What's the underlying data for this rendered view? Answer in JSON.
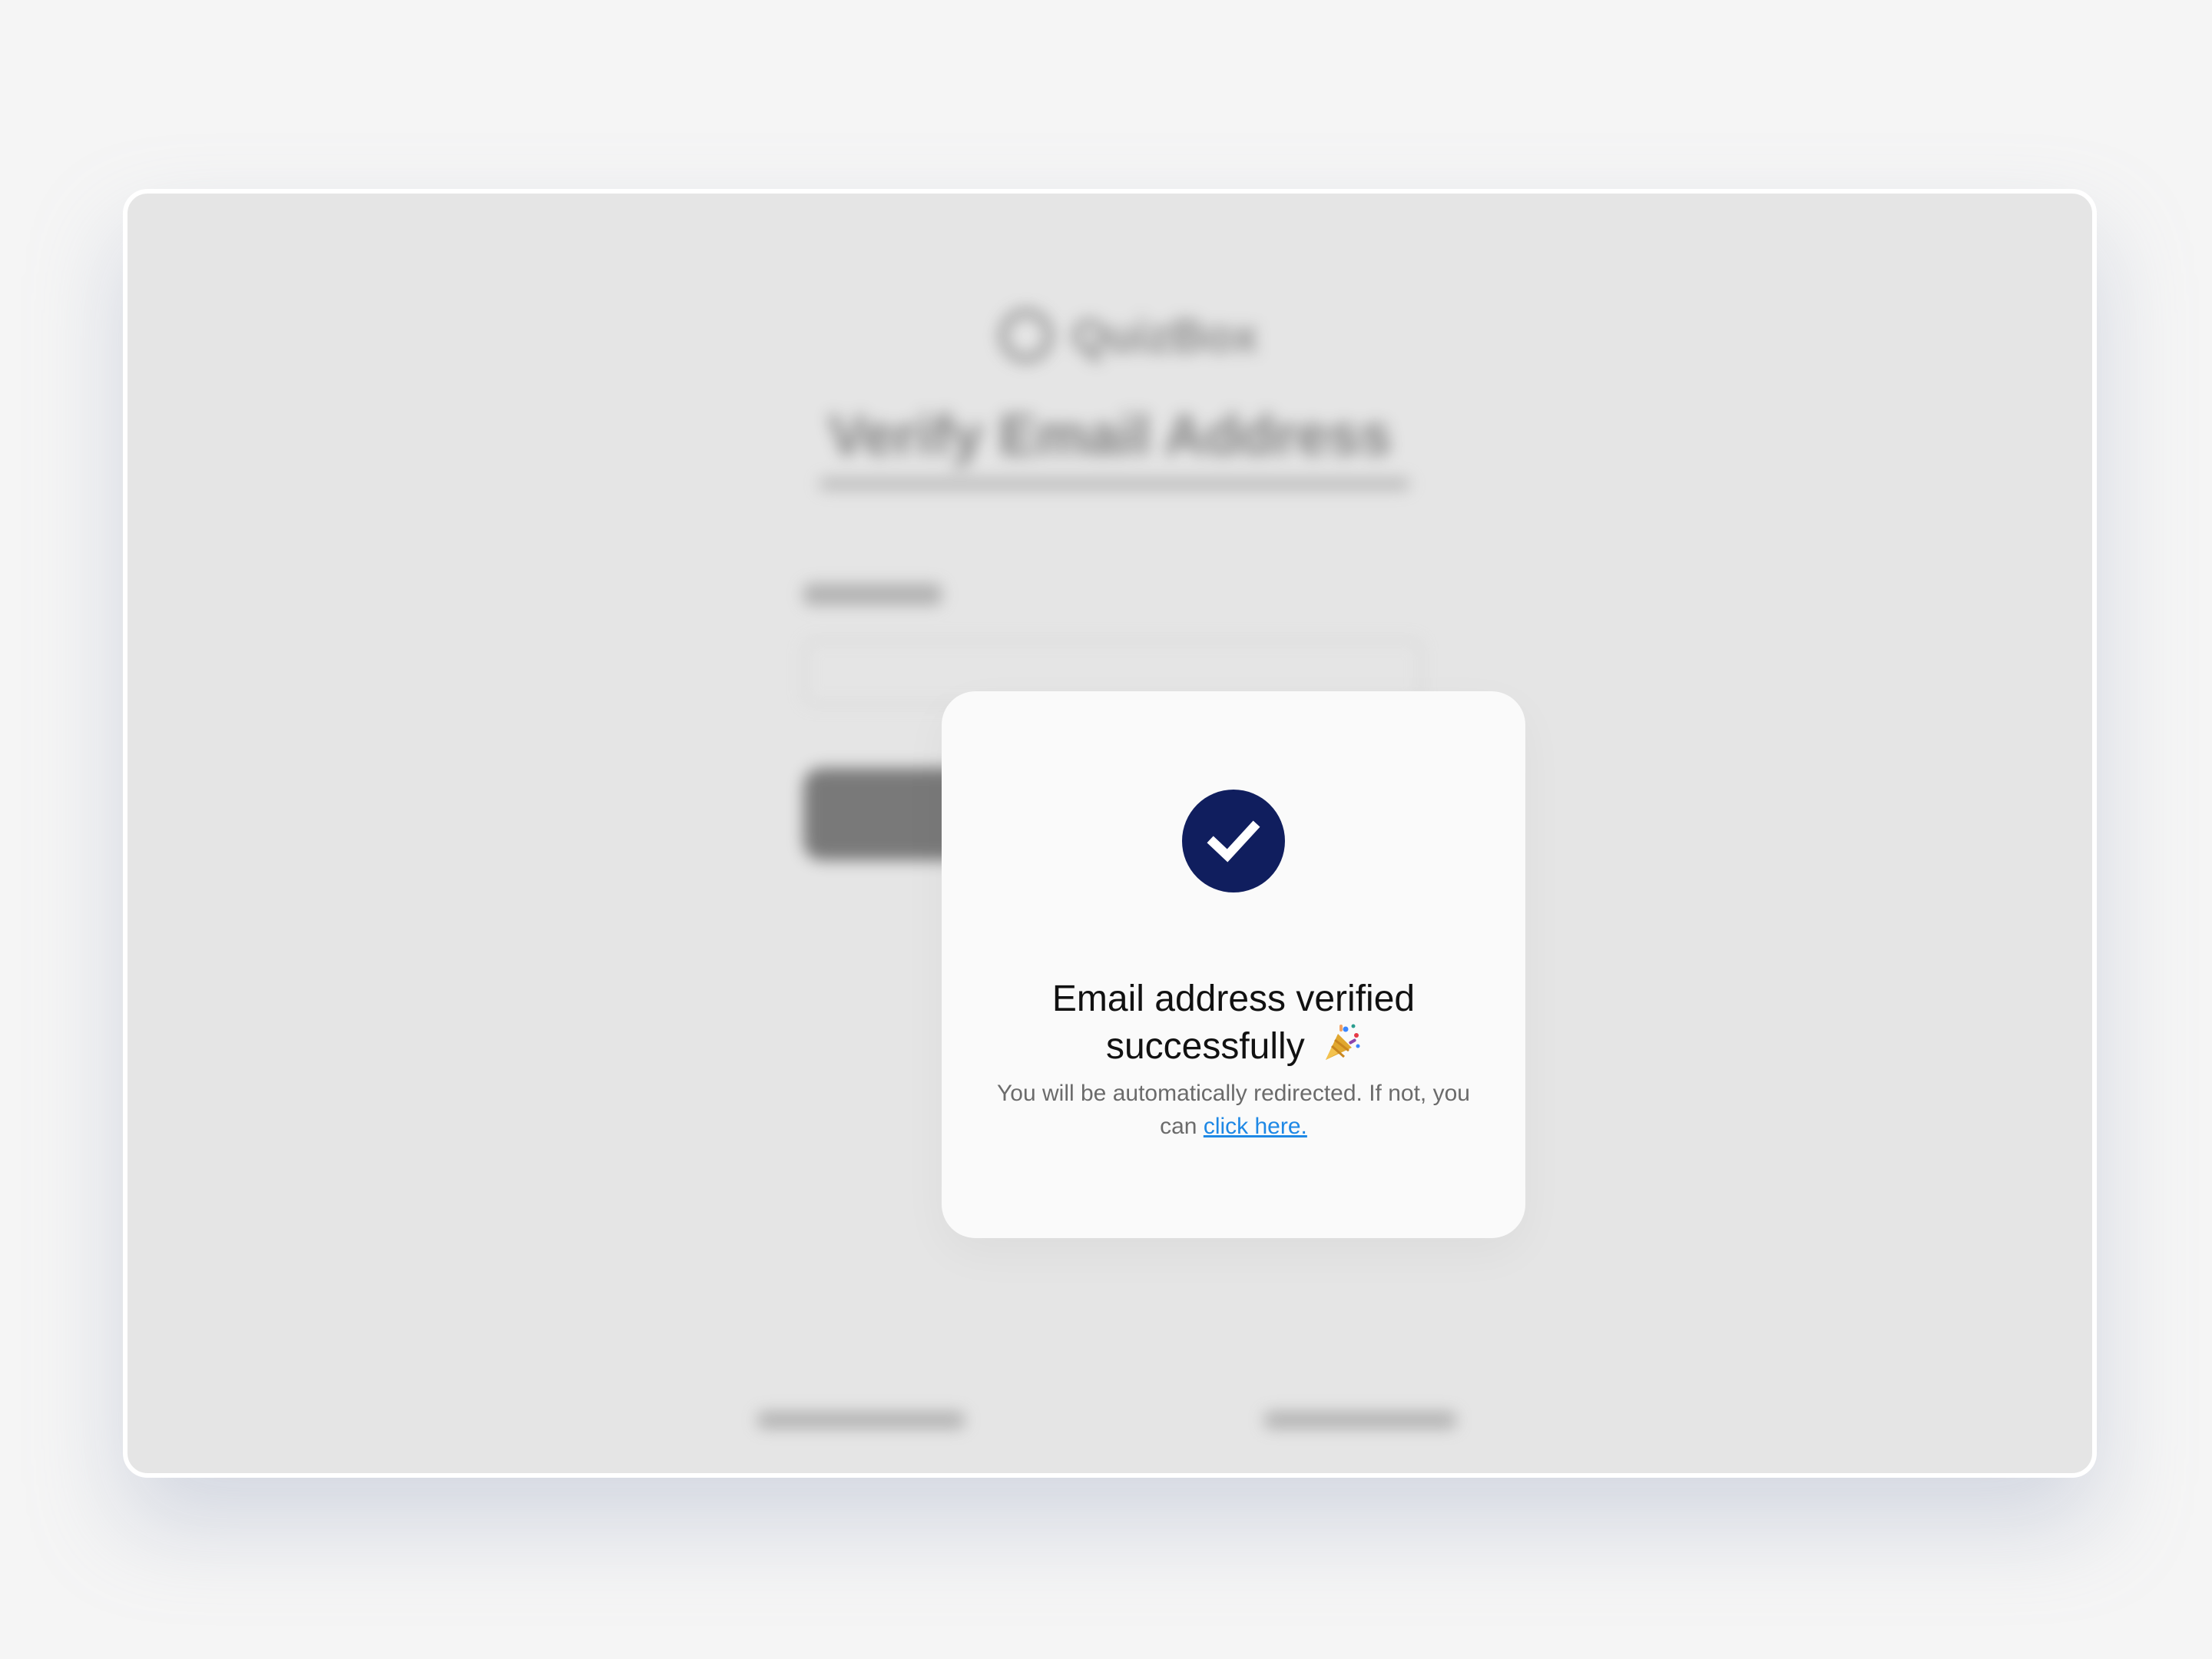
{
  "background_page": {
    "brand_name": "QuizBox",
    "title": "Verify Email Address"
  },
  "modal": {
    "icon": "check-circle-icon",
    "icon_color": "#101e5e",
    "title_line1": "Email address verified",
    "title_line2": "successfully",
    "title_emoji": "party-popper-icon",
    "message": "You will be automatically redirected. If not, you can",
    "link_label": "click here.",
    "link_color": "#1e88e5"
  }
}
